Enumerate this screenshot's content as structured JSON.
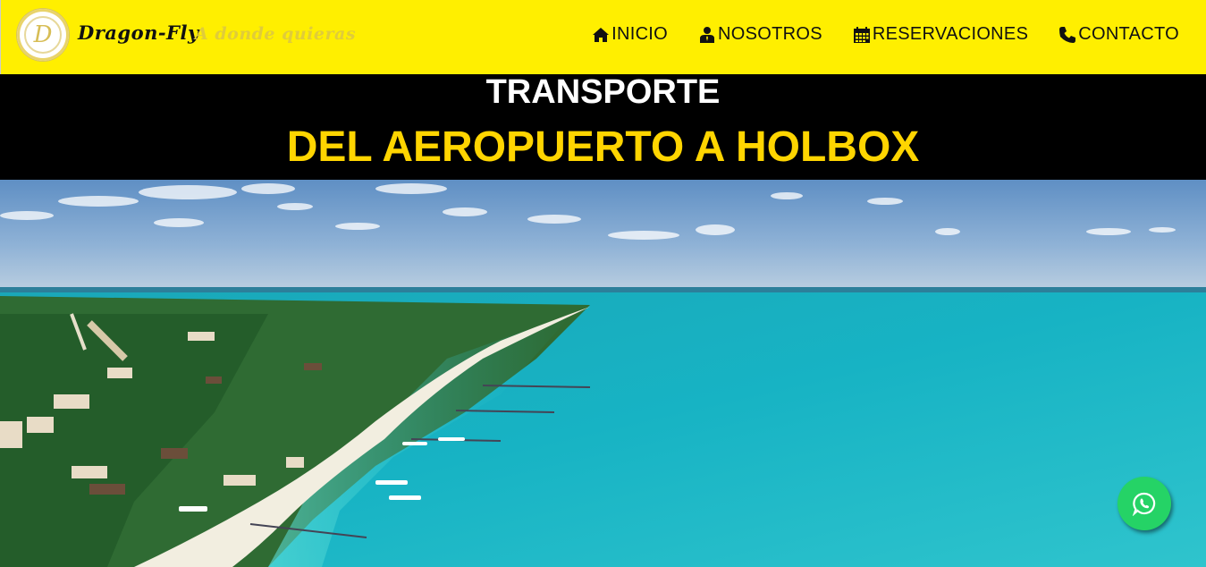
{
  "header": {
    "brand": "Dragon-Fly",
    "tagline": "A donde quieras",
    "logo_letter": "D",
    "colors": {
      "bar": "#ffef00",
      "tagline": "#e0cc3a"
    }
  },
  "nav": {
    "items": [
      {
        "label": "INICIO",
        "icon": "home-icon"
      },
      {
        "label": "NOSOTROS",
        "icon": "user-icon"
      },
      {
        "label": "RESERVACIONES",
        "icon": "calendar-icon"
      },
      {
        "label": "CONTACTO",
        "icon": "phone-icon"
      }
    ]
  },
  "hero": {
    "line1": "TRANSPORTE",
    "line2": "DEL AEROPUERTO A HOLBOX",
    "colors": {
      "line1": "#ffffff",
      "line2": "#ffd500",
      "background": "#000000"
    },
    "image": "aerial-beach-photo"
  },
  "whatsapp": {
    "icon": "whatsapp-icon",
    "color": "#25d366"
  }
}
